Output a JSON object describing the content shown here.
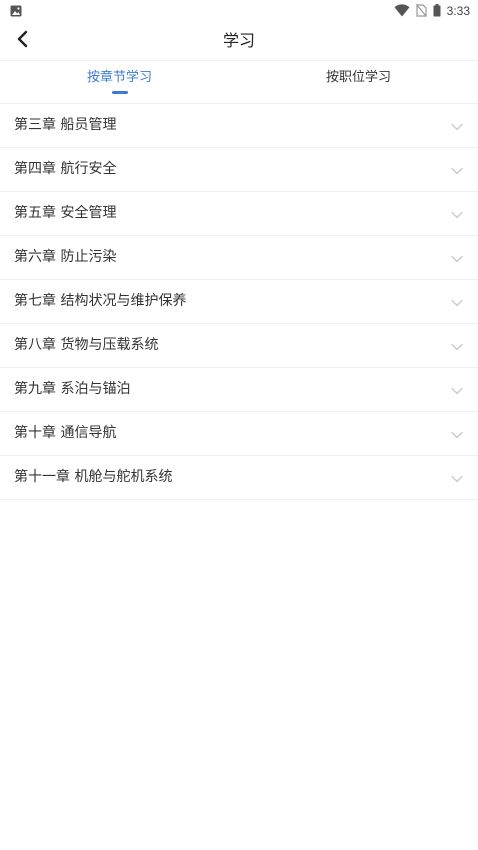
{
  "status_bar": {
    "time": "3:33",
    "icons": [
      "image-notification-icon",
      "wifi-icon",
      "no-sim-icon",
      "battery-icon"
    ]
  },
  "header": {
    "title": "学习",
    "back_icon": "chevron-left-icon"
  },
  "tabs": [
    {
      "label": "按章节学习",
      "active": true
    },
    {
      "label": "按职位学习",
      "active": false
    }
  ],
  "colors": {
    "accent": "#3a7bd5",
    "text": "#333333",
    "divider": "#f0f0f0",
    "chevron": "#c8c8c8"
  },
  "chapters": [
    {
      "label": "第三章 船员管理"
    },
    {
      "label": "第四章 航行安全"
    },
    {
      "label": "第五章 安全管理"
    },
    {
      "label": "第六章 防止污染"
    },
    {
      "label": "第七章 结构状况与维护保养"
    },
    {
      "label": "第八章 货物与压载系统"
    },
    {
      "label": "第九章 系泊与锚泊"
    },
    {
      "label": "第十章 通信导航"
    },
    {
      "label": "第十一章 机舱与舵机系统"
    }
  ]
}
